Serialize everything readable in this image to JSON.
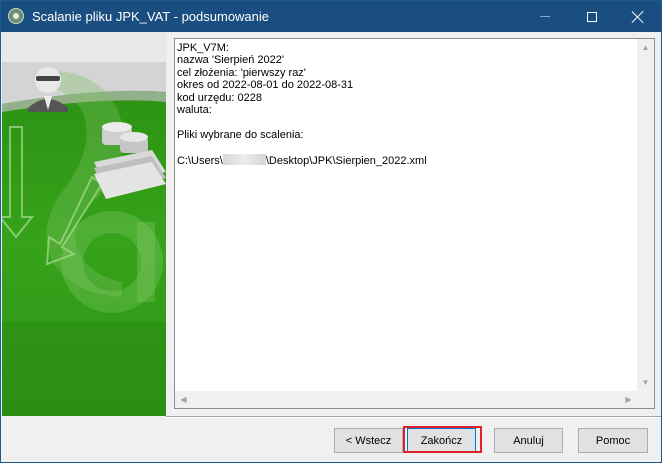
{
  "window": {
    "title": "Scalanie pliku JPK_VAT - podsumowanie",
    "icon": "gt-app-icon",
    "controls": [
      "minimize-icon",
      "maximize-icon",
      "close-icon"
    ]
  },
  "summary": {
    "lines": [
      "JPK_V7M:",
      "nazwa 'Sierpień 2022'",
      "cel złożenia: 'pierwszy raz'",
      "okres od 2022-08-01 do 2022-08-31",
      "kod urzędu: 0228",
      "waluta:",
      "",
      "Pliki wybrane do scalenia:",
      ""
    ],
    "file_path_prefix": "C:\\Users\\",
    "file_path_suffix": "\\Desktop\\JPK\\Sierpien_2022.xml"
  },
  "buttons": {
    "back": "< Wstecz",
    "finish": "Zakończ",
    "cancel": "Anuluj",
    "help": "Pomoc"
  },
  "colors": {
    "titlebar": "#1a4e80",
    "panel_green": "#2f9a17",
    "highlight": "#e0202a"
  }
}
